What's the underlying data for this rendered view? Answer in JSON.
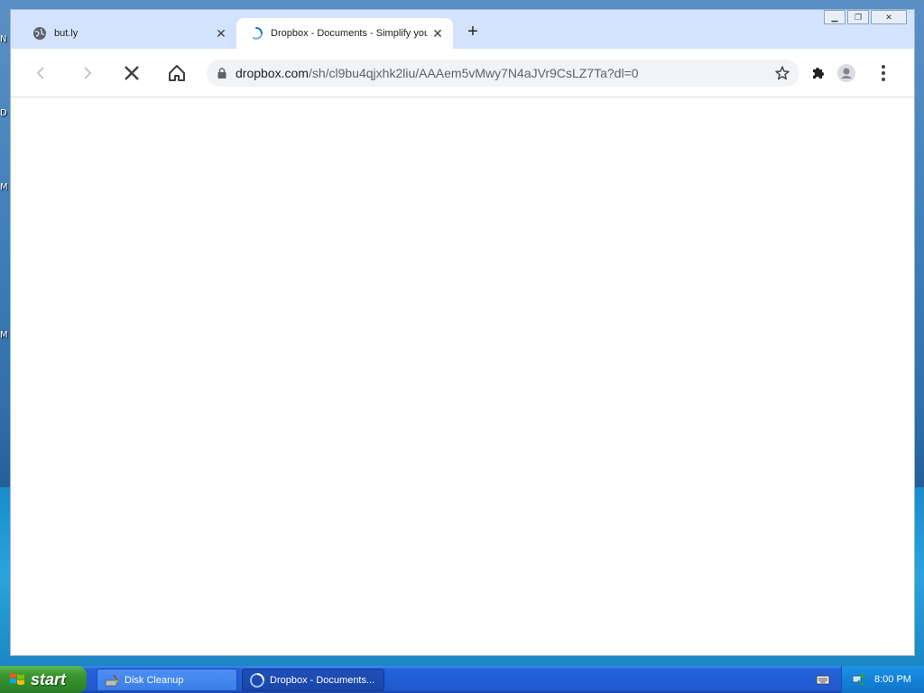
{
  "desktop": {
    "stubs": [
      "N",
      "D",
      "M",
      "M"
    ]
  },
  "browser": {
    "tabs": [
      {
        "title": "but.ly",
        "icon": "globe-icon",
        "active": false
      },
      {
        "title": "Dropbox - Documents - Simplify your",
        "icon": "loading-spinner-icon",
        "active": true
      }
    ],
    "new_tab_label": "+",
    "toolbar": {
      "back_icon": "back-arrow-icon",
      "forward_icon": "forward-arrow-icon",
      "stop_icon": "stop-icon",
      "home_icon": "home-icon"
    },
    "omnibox": {
      "url_domain": "dropbox.com",
      "url_path": "/sh/cl9bu4qjxhk2liu/AAAem5vMwy7N4aJVr9CsLZ7Ta?dl=0"
    }
  },
  "taskbar": {
    "start_label": "start",
    "tasks": [
      {
        "label": "Disk Cleanup",
        "icon": "disk-cleanup-icon",
        "active": false
      },
      {
        "label": "Dropbox - Documents...",
        "icon": "browser-icon",
        "active": true
      }
    ],
    "clock": "8:00 PM"
  },
  "colors": {
    "tabstrip_bg": "#d3e3fd",
    "taskbar_blue": "#225ed6",
    "start_green": "#3b9a32"
  }
}
